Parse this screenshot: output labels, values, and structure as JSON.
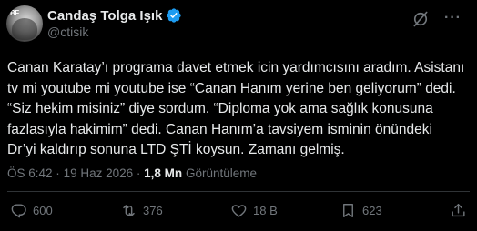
{
  "author": {
    "display_name": "Candaş Tolga Işık",
    "handle": "@ctisik",
    "verified": true
  },
  "tweet": {
    "lines": [
      "Canan Karatay’ı programa davet etmek icin yardımcısını aradım. Asistanı",
      "tv mi youtube mi youtube ise “Canan Hanım yerine ben geliyorum” dedi.",
      "“Siz hekim misiniz” diye sordum. “Diploma yok ama sağlık konusuna",
      "fazlasıyla hakimim” dedi. Canan Hanım’a tavsiyem isminin önündeki",
      "Dr’yi kaldırıp sonuna LTD ŞTİ koysun. Zamanı gelmiş."
    ],
    "time": "ÖS 6:42",
    "separator": "·",
    "date": "19 Haz 2026",
    "views_count": "1,8 Mn",
    "views_label": "Görüntüleme"
  },
  "actions": {
    "replies": "600",
    "reposts": "376",
    "likes": "18 B",
    "bookmarks": "623"
  },
  "colors": {
    "background": "#000000",
    "text": "#e7e9ea",
    "muted": "#71767b",
    "verified": "#1d9bf0",
    "divider": "#2f3336"
  }
}
